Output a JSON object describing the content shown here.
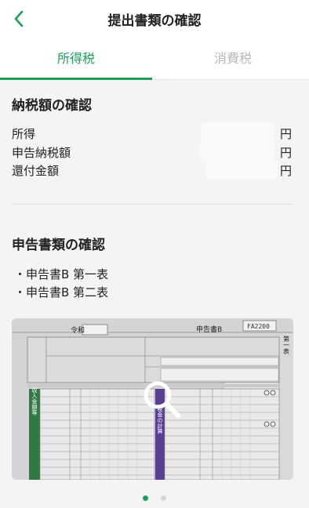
{
  "header": {
    "title": "提出書類の確認",
    "back_icon": "chevron-left-icon"
  },
  "tabs": [
    {
      "label": "所得税",
      "active": true
    },
    {
      "label": "消費税",
      "active": false
    }
  ],
  "tax_summary": {
    "title": "納税額の確認",
    "rows": [
      {
        "label": "所得",
        "unit": "円"
      },
      {
        "label": "申告納税額",
        "unit": "円"
      },
      {
        "label": "還付金額",
        "unit": "円"
      }
    ]
  },
  "documents": {
    "title": "申告書類の確認",
    "items": [
      "・申告書B 第一表",
      "・申告書B 第二表"
    ]
  },
  "preview": {
    "era": "令和",
    "form_name": "申告書B",
    "side_title": "第一表",
    "code": "FA2200",
    "sections": [
      "収入金額等",
      "税金の計算"
    ],
    "zoom_icon": "magnifier-icon"
  },
  "pagination": {
    "current": 1,
    "total": 2
  },
  "colors": {
    "accent": "#1f9e5a",
    "inactive_tab": "#b8b8b8",
    "form_purple": "#5b3f94",
    "form_green": "#2f7a44"
  }
}
